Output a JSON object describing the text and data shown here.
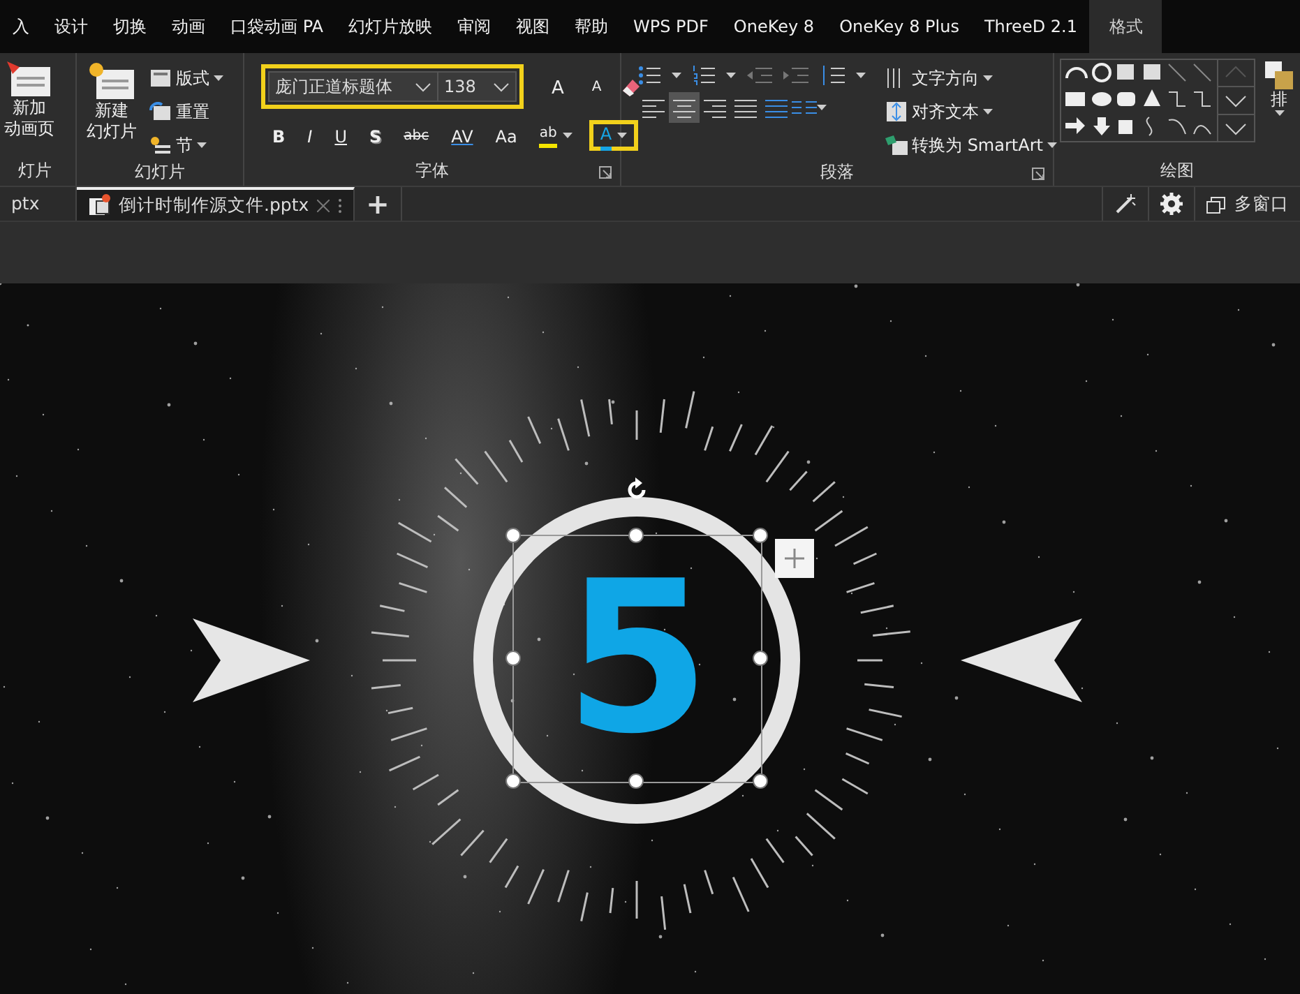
{
  "menu_tabs": [
    {
      "label": "入",
      "selected": false
    },
    {
      "label": "设计",
      "selected": false
    },
    {
      "label": "切换",
      "selected": false
    },
    {
      "label": "动画",
      "selected": false
    },
    {
      "label": "口袋动画 PA",
      "selected": false
    },
    {
      "label": "幻灯片放映",
      "selected": false
    },
    {
      "label": "审阅",
      "selected": false
    },
    {
      "label": "视图",
      "selected": false
    },
    {
      "label": "帮助",
      "selected": false
    },
    {
      "label": "WPS PDF",
      "selected": false
    },
    {
      "label": "OneKey 8",
      "selected": false
    },
    {
      "label": "OneKey 8 Plus",
      "selected": false
    },
    {
      "label": "ThreeD 2.1",
      "selected": false
    },
    {
      "label": "格式",
      "selected": true
    }
  ],
  "ribbon_groups": [
    {
      "kind": "new-page",
      "label": "灯片",
      "button_lines": [
        "新加",
        "动画页"
      ]
    },
    {
      "kind": "slides",
      "label": "幻灯片",
      "new_slide_lines": [
        "新建",
        "幻灯片"
      ],
      "items": [
        "版式",
        "重置",
        "节"
      ]
    },
    {
      "kind": "font",
      "label": "字体",
      "font_name": "庞门正道标题体",
      "font_size": "138",
      "font_box_highlighted": true,
      "grow_font": "A",
      "shrink_font": "A",
      "format_buttons": [
        {
          "kind": "bold",
          "label": "B"
        },
        {
          "kind": "italic",
          "label": "I"
        },
        {
          "kind": "underline",
          "label": "U"
        },
        {
          "kind": "shadow",
          "label": "S"
        },
        {
          "kind": "strike",
          "label": "abc"
        },
        {
          "kind": "spacing",
          "label": "AV"
        },
        {
          "kind": "case",
          "label": "Aa"
        }
      ],
      "highlight_glyph": "ab",
      "font_color_glyph": "A",
      "font_color_highlighted": true
    },
    {
      "kind": "paragraph",
      "label": "段落",
      "items": [
        "文字方向",
        "对齐文本",
        "转换为 SmartArt"
      ],
      "alignment_buttons": [
        {
          "selected": false
        },
        {
          "selected": true
        },
        {
          "selected": false
        },
        {
          "selected": false
        },
        {
          "selected": false
        }
      ]
    },
    {
      "kind": "drawing",
      "label": "绘图",
      "arrange": "排"
    }
  ],
  "doc_tabs": [
    {
      "label": "ptx",
      "selected": false
    },
    {
      "label": "倒计时制作源文件.pptx",
      "selected": true
    }
  ],
  "new_tab": "+",
  "window_tool": "多窗口",
  "slide": {
    "number": "5",
    "selected": true
  }
}
